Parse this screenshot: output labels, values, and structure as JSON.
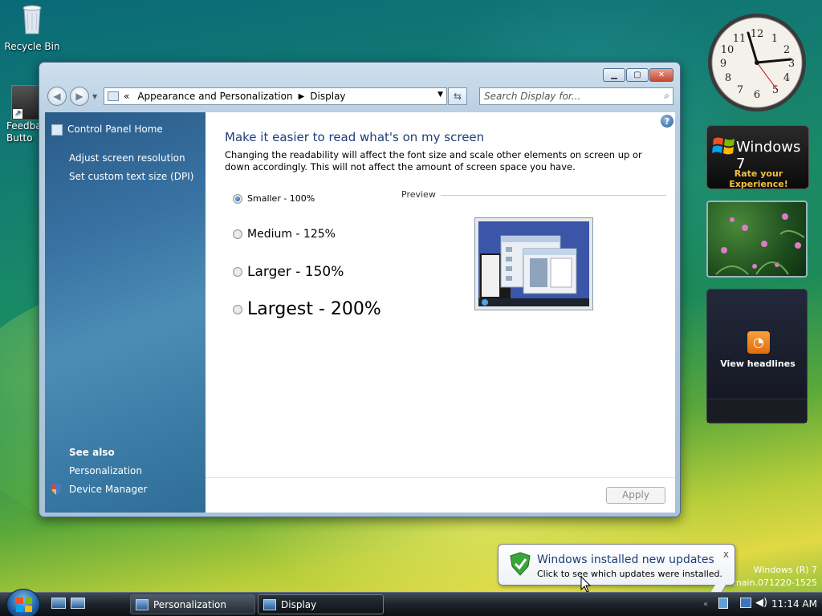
{
  "desktop": {
    "icons": [
      {
        "label": "Recycle Bin",
        "icon": "recycle-bin-icon"
      },
      {
        "label": "Feedba Butto",
        "icon": "shortcut-icon"
      }
    ],
    "watermark_line1": "Windows (R) 7",
    "watermark_line2": "main.071220-1525"
  },
  "window": {
    "address": {
      "chevron": "«",
      "crumbs": [
        "Appearance and Personalization",
        "Display"
      ]
    },
    "search_placeholder": "Search Display for...",
    "sidebar": {
      "home": "Control Panel Home",
      "links": [
        "Adjust screen resolution",
        "Set custom text size (DPI)"
      ],
      "see_also": "See also",
      "see_also_links": [
        "Personalization",
        "Device Manager"
      ]
    },
    "content": {
      "title": "Make it easier to read what's on my screen",
      "description": "Changing the readability will affect the font size and scale other elements on screen up or down accordingly. This will not affect the amount of screen space you have.",
      "options": [
        {
          "label": "Smaller - 100%",
          "selected": true
        },
        {
          "label": "Medium - 125%",
          "selected": false
        },
        {
          "label": "Larger - 150%",
          "selected": false
        },
        {
          "label": "Largest - 200%",
          "selected": false
        }
      ],
      "preview_label": "Preview",
      "apply_label": "Apply",
      "help_label": "?"
    }
  },
  "gadgets": {
    "clock": {
      "hour": 11,
      "minute": 14
    },
    "windows7": {
      "brand": "Windows 7",
      "cta": "Rate your Experience!"
    },
    "news": {
      "label": "View headlines"
    }
  },
  "notification": {
    "title": "Windows installed new updates",
    "subtitle": "Click to see which updates were installed.",
    "close": "x"
  },
  "taskbar": {
    "buttons": [
      {
        "label": "Personalization",
        "active": false
      },
      {
        "label": "Display",
        "active": true
      }
    ],
    "time": "11:14 AM"
  },
  "colors": {
    "link_title": "#1e3d7a",
    "sidebar_blue": "#3872a3"
  }
}
